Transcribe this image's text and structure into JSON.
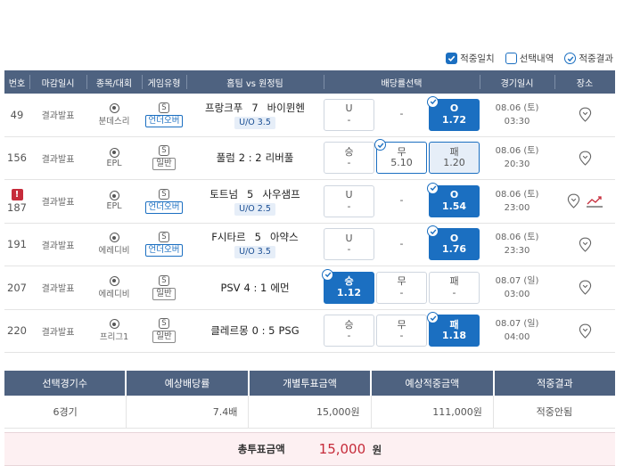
{
  "legend": {
    "hit": "적중일치",
    "selection": "선택내역",
    "result": "적중결과"
  },
  "headers": [
    "번호",
    "마감일시",
    "종목/대회",
    "게임유형",
    "홈팀 vs 원정팀",
    "배당률선택",
    "경기일시",
    "장소"
  ],
  "colors": {
    "header": "#4e6280",
    "accent": "#1b6fc1",
    "total_bg": "#fdf0f2",
    "total_amount": "#c62b3a"
  },
  "rows": [
    {
      "num": "49",
      "status": "결과발표",
      "league": "분데스리",
      "type_icon": "S",
      "type": "언더오버",
      "type_uo": true,
      "home": "프랑크푸",
      "score": "7",
      "away": "바이뮌헨",
      "uo": "U/O 3.5",
      "odds": [
        {
          "label": "U",
          "value": "-"
        },
        {
          "label": "-",
          "value": ""
        },
        {
          "label": "O",
          "value": "1.72"
        }
      ],
      "date": "08.06 (토)",
      "time": "03:30"
    },
    {
      "num": "156",
      "status": "결과발표",
      "league": "EPL",
      "type_icon": "S",
      "type": "일반",
      "type_uo": false,
      "home": "풀럼",
      "score": "2 : 2",
      "away": "리버풀",
      "uo": "",
      "odds": [
        {
          "label": "승",
          "value": "-"
        },
        {
          "label": "무",
          "value": "5.10"
        },
        {
          "label": "패",
          "value": "1.20"
        }
      ],
      "date": "08.06 (토)",
      "time": "20:30"
    },
    {
      "num": "187",
      "status": "결과발표",
      "league": "EPL",
      "type_icon": "S",
      "type": "언더오버",
      "type_uo": true,
      "home": "토트넘",
      "score": "5",
      "away": "사우샘프",
      "uo": "U/O 2.5",
      "odds": [
        {
          "label": "U",
          "value": "-"
        },
        {
          "label": "-",
          "value": ""
        },
        {
          "label": "O",
          "value": "1.54"
        }
      ],
      "date": "08.06 (토)",
      "time": "23:00"
    },
    {
      "num": "191",
      "status": "결과발표",
      "league": "에레디비",
      "type_icon": "S",
      "type": "언더오버",
      "type_uo": true,
      "home": "F시타르",
      "score": "5",
      "away": "아약스",
      "uo": "U/O 3.5",
      "odds": [
        {
          "label": "U",
          "value": "-"
        },
        {
          "label": "-",
          "value": ""
        },
        {
          "label": "O",
          "value": "1.76"
        }
      ],
      "date": "08.06 (토)",
      "time": "23:30"
    },
    {
      "num": "207",
      "status": "결과발표",
      "league": "에레디비",
      "type_icon": "S",
      "type": "일반",
      "type_uo": false,
      "home": "PSV",
      "score": "4 : 1",
      "away": "에먼",
      "uo": "",
      "odds": [
        {
          "label": "승",
          "value": "1.12"
        },
        {
          "label": "무",
          "value": "-"
        },
        {
          "label": "패",
          "value": "-"
        }
      ],
      "date": "08.07 (일)",
      "time": "03:00"
    },
    {
      "num": "220",
      "status": "결과발표",
      "league": "프리그1",
      "type_icon": "S",
      "type": "일반",
      "type_uo": false,
      "home": "클레르몽",
      "score": "0 : 5",
      "away": "PSG",
      "uo": "",
      "odds": [
        {
          "label": "승",
          "value": "-"
        },
        {
          "label": "무",
          "value": "-"
        },
        {
          "label": "패",
          "value": "1.18"
        }
      ],
      "date": "08.07 (일)",
      "time": "04:00"
    }
  ],
  "summary": {
    "headers": [
      "선택경기수",
      "예상배당률",
      "개별투표금액",
      "예상적중금액",
      "적중결과"
    ],
    "values": [
      "6경기",
      "7.4배",
      "15,000원",
      "111,000원",
      "적중안됨"
    ]
  },
  "total": {
    "label": "총투표금액",
    "amount": "15,000",
    "unit": "원"
  }
}
